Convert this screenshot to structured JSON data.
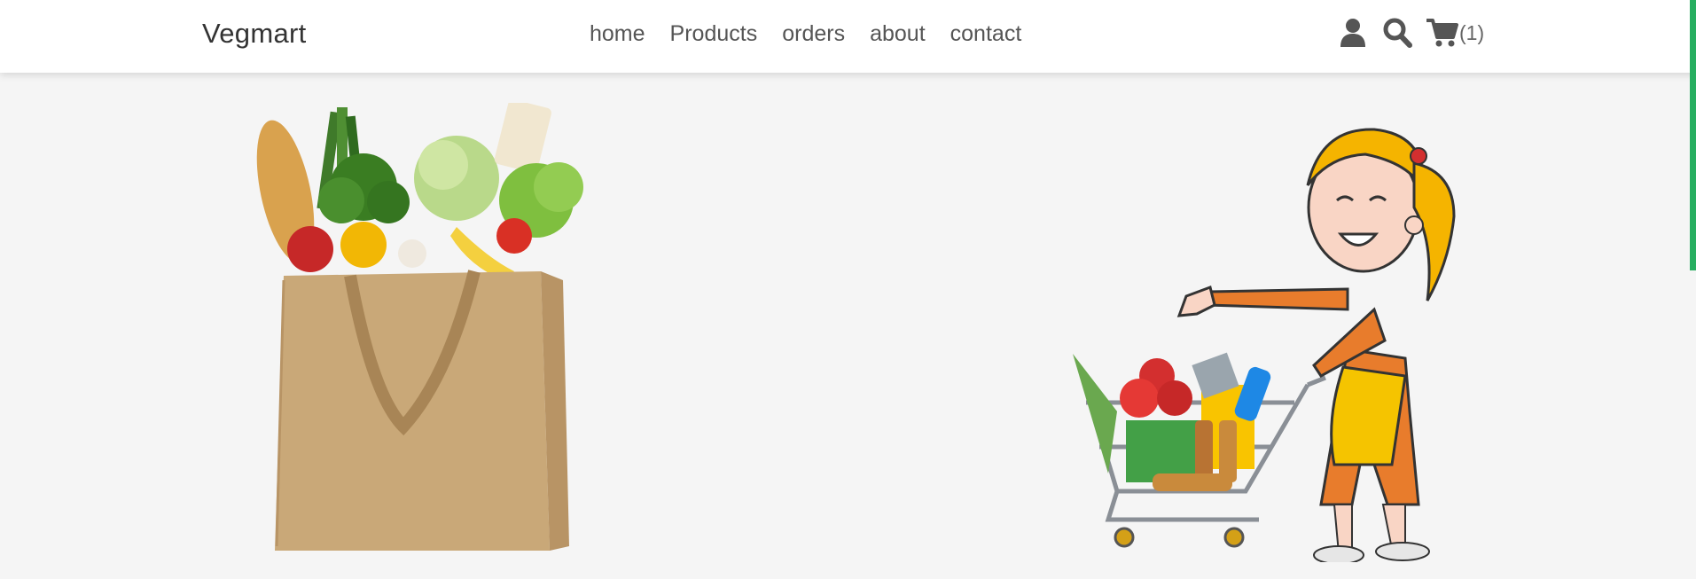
{
  "header": {
    "brand": "Vegmart",
    "nav": [
      {
        "label": "home"
      },
      {
        "label": "Products"
      },
      {
        "label": "orders"
      },
      {
        "label": "about"
      },
      {
        "label": "contact"
      }
    ],
    "cart_count": "(1)",
    "icons": [
      "user-icon",
      "search-icon",
      "cart-icon"
    ]
  },
  "colors": {
    "accent": "#27ae60",
    "text": "#333333",
    "nav_text": "#555555",
    "background": "#f5f5f5"
  }
}
